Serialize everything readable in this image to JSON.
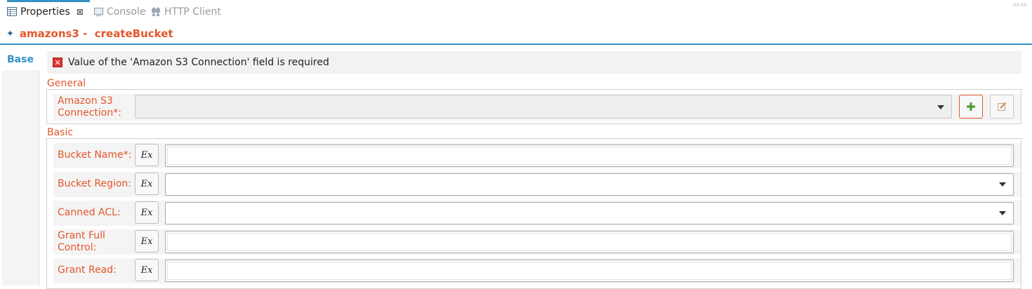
{
  "tabs": [
    {
      "label": "Properties",
      "icon": "properties-icon"
    },
    {
      "label": "Console",
      "icon": "console-icon"
    },
    {
      "label": "HTTP Client",
      "icon": "http-client-icon"
    }
  ],
  "header": {
    "title": "amazons3 -  createBucket",
    "icon": "connector-icon"
  },
  "side_tabs": [
    {
      "label": "Base"
    }
  ],
  "error": {
    "message": "Value of the 'Amazon S3 Connection' field is required",
    "icon": "error-icon"
  },
  "groups": {
    "general": {
      "label": "General",
      "connection_label_line1": "Amazon S3",
      "connection_label_line2": "Connection*:",
      "connection_value": ""
    },
    "basic": {
      "label": "Basic",
      "fields": [
        {
          "line1": "Bucket Name*:",
          "line2": "",
          "type": "text",
          "value": ""
        },
        {
          "line1": "Bucket Region:",
          "line2": "",
          "type": "select",
          "value": ""
        },
        {
          "line1": "Canned ACL:",
          "line2": "",
          "type": "select",
          "value": ""
        },
        {
          "line1": "Grant Full",
          "line2": "Control:",
          "type": "text",
          "value": ""
        },
        {
          "line1": "Grant Read:",
          "line2": "",
          "type": "text",
          "value": ""
        }
      ]
    }
  },
  "ex_label": "Ex",
  "colors": {
    "accent": "#3592c4",
    "label": "#e2572b",
    "error": "#d9342b",
    "add": "#4a9a2a"
  }
}
